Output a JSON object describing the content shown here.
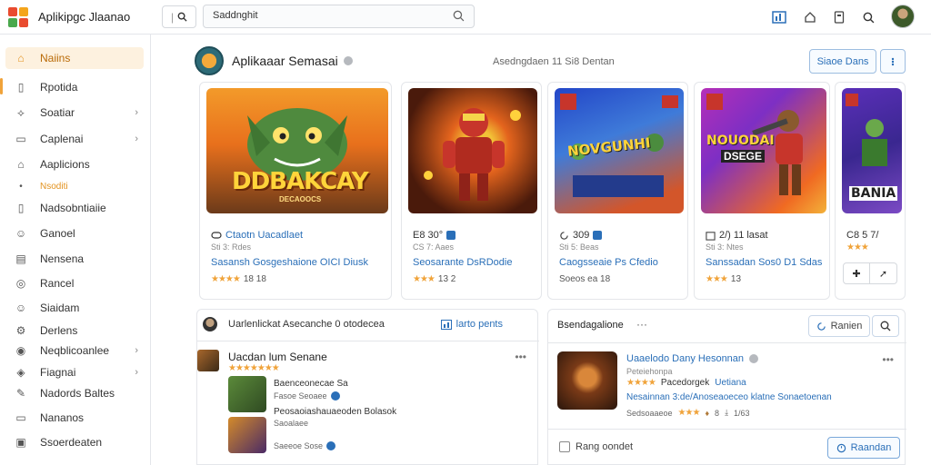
{
  "app": {
    "title": "Aplikipgc Jlaanao"
  },
  "search": {
    "value": "Saddnghit"
  },
  "sidebar": {
    "items": [
      {
        "label": "Naiins",
        "icon": "home-icon",
        "active": true
      },
      {
        "label": "Rpotida",
        "icon": "bookmark-icon"
      },
      {
        "label": "Soatiar",
        "icon": "tag-icon",
        "chevron": true
      },
      {
        "label": "Caplenai",
        "icon": "folder-icon",
        "chevron": true
      },
      {
        "label": "Aaplicions",
        "icon": "apps-icon"
      },
      {
        "label": "Nsoditi",
        "icon": "dot-icon",
        "sub": true
      },
      {
        "label": "Nadsobntiaiie",
        "icon": "list-icon"
      },
      {
        "label": "Ganoel",
        "icon": "controller-icon"
      },
      {
        "label": "Nensena",
        "icon": "document-icon"
      },
      {
        "label": "Rancel",
        "icon": "globe-icon"
      },
      {
        "label": "Siaidam",
        "icon": "users-icon"
      },
      {
        "label": "Derlens",
        "icon": "settings-icon"
      },
      {
        "label": "Neqblicoanlee",
        "icon": "person-icon",
        "chevron": true
      },
      {
        "label": "Fiagnai",
        "icon": "shield-icon",
        "chevron": true
      },
      {
        "label": "Nadords Baltes",
        "icon": "pen-icon"
      },
      {
        "label": "Nananos",
        "icon": "archive-icon"
      },
      {
        "label": "Ssoerdeaten",
        "icon": "calendar-icon"
      }
    ]
  },
  "publisher": {
    "name": "Aplikaaar Semasai",
    "meta": "Asedngdaen 11 Si8 Dentan",
    "save_label": "Siaoe Dans"
  },
  "games": [
    {
      "art_text": "DDBAKCAY",
      "art_sub": "DECAOOCS",
      "line1": "Ctaotn Uacadlaet",
      "meta": "Sti  3:  Rdes",
      "line2": "Sasansh Gosgeshaione OICI Diusk",
      "rating_text": "18 18"
    },
    {
      "art_text": "",
      "line1": "E8 30°",
      "meta": "CS  7:  Aaes",
      "line2": "Seosarante DsRDodie",
      "rating_text": "13 2"
    },
    {
      "art_text": "NOVGUNHI",
      "line1": "309",
      "meta": "Sti  5:  Beas",
      "line2": "Caogsseaie Ps Cfedio",
      "rating_text": "Soeos ea 18"
    },
    {
      "art_text": "NOUODAI",
      "art_sub": "DSEGE",
      "line1": "2/) 11 lasat",
      "meta": "Sti  3:  Ntes",
      "line2": "Sanssadan Sos0 D1 Sdas",
      "rating_text": "13"
    },
    {
      "art_text": "BANIA",
      "line1": "C8 5 7/",
      "meta": "",
      "line2": "",
      "rating_text": ""
    }
  ],
  "feed": {
    "header": "Uarlenlickat Asecanche 0 otodecea",
    "header_link": "larto pents",
    "post_title": "Uacdan lum Senane",
    "items": [
      {
        "line1": "Baenceonecae  Sa",
        "line2": "Fasoe  Seoaee"
      },
      {
        "line1": "Peosaoiashauaeoden Bolasok",
        "line2": "Saoalaee",
        "line3": "Saeeoe Sose"
      }
    ]
  },
  "recommend": {
    "title": "Bsendagalione",
    "filter_label": "Ranien",
    "item": {
      "name": "Uaaelodo Dany Hesonnan",
      "sub": "Peteiehonpa",
      "l3_label": "Pacedorgek",
      "l3_link": "Uetiana",
      "l4": "Nesainnan 3:de/Anoseaoeceo klatne Sonaetoenan",
      "l5_prefix": "Sedsoaaeoe",
      "l5_count": "8",
      "l5_suffix": "1/63"
    },
    "checkbox_label": "Rang oondet",
    "cta_label": "Raandan"
  },
  "colors": {
    "accent": "#f0a33a",
    "link": "#2a6fb8",
    "border": "#e4e6ea"
  }
}
